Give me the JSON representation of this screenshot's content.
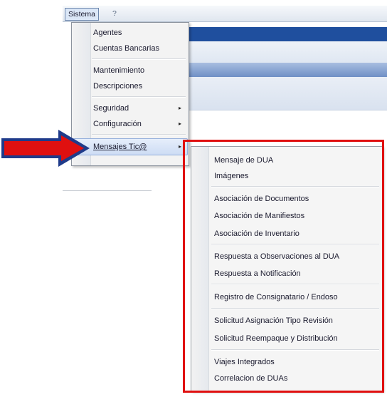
{
  "menubar": {
    "sistema": "Sistema",
    "help": "?"
  },
  "main_menu": {
    "items": [
      {
        "label": "Agentes",
        "submenu": false
      },
      {
        "label": "Cuentas Bancarias",
        "submenu": false
      },
      {
        "label": "Mantenimiento",
        "submenu": false
      },
      {
        "label": "Descripciones",
        "submenu": false
      },
      {
        "label": "Seguridad",
        "submenu": true
      },
      {
        "label": "Configuración",
        "submenu": true
      },
      {
        "label": "Mensajes Tic@",
        "submenu": true,
        "highlighted": true
      }
    ]
  },
  "sub_menu": {
    "items": [
      "Mensaje de DUA",
      "Imágenes",
      "Asociación de Documentos",
      "Asociación de Manifiestos",
      "Asociación de Inventario",
      "Respuesta a Observaciones al DUA",
      "Respuesta a Notificación",
      "Registro de Consignatario / Endoso",
      "Solicitud Asignación Tipo Revisión",
      "Solicitud Reempaque y Distribución",
      "Viajes Integrados",
      "Correlacion de DUAs"
    ]
  },
  "colors": {
    "annotation_red": "#e01010",
    "arrow_outline": "#1f3b8a",
    "highlight": "#cddcf4"
  },
  "icons": {
    "submenu_arrow": "▸"
  }
}
